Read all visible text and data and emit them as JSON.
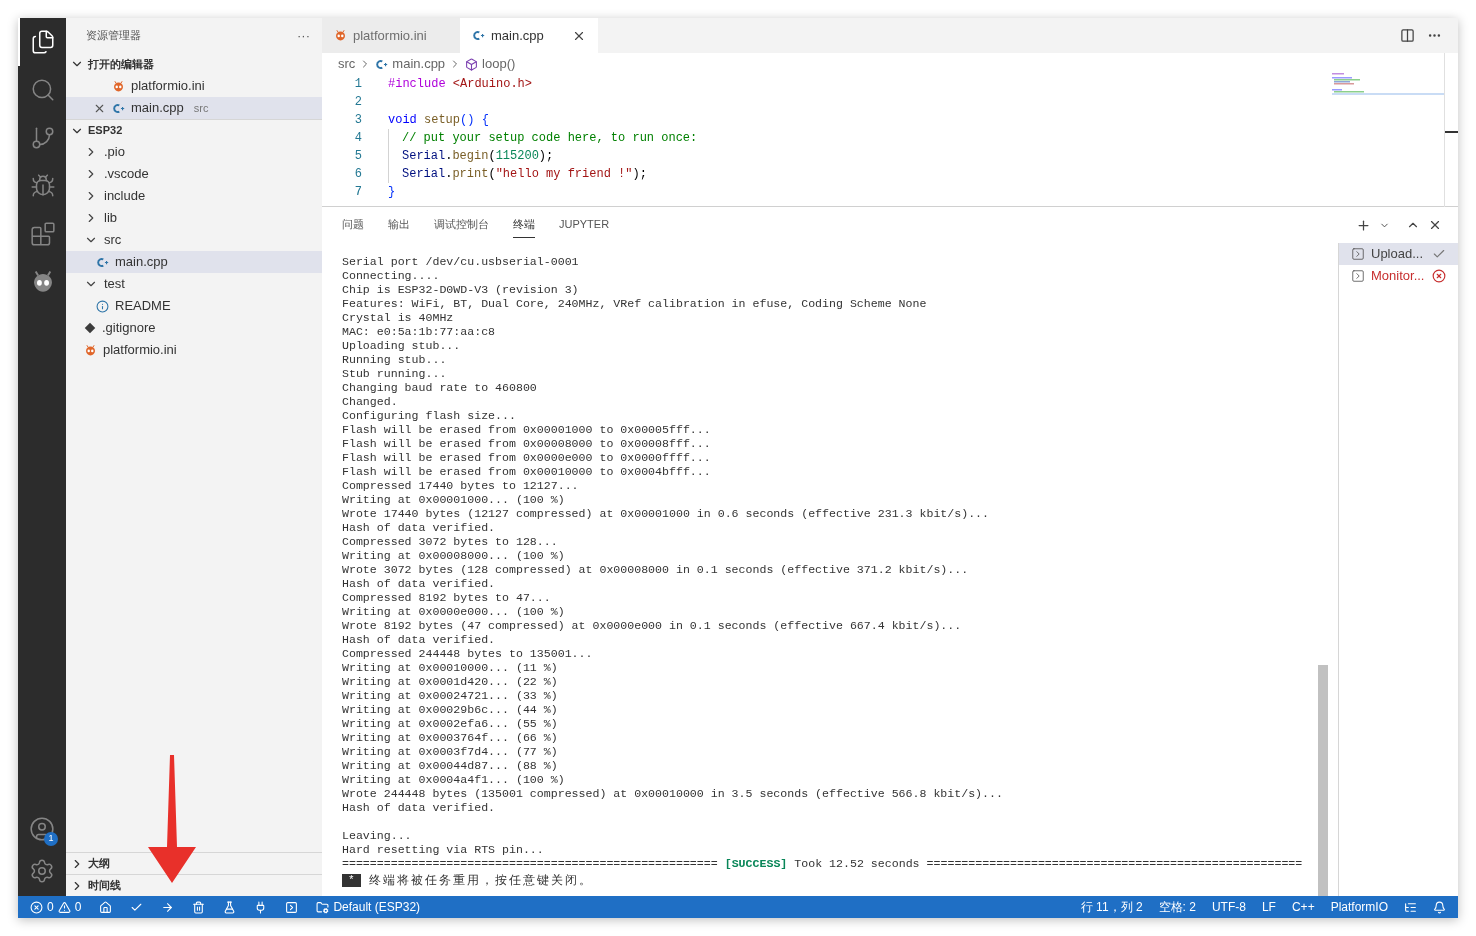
{
  "activity_bar": {
    "items": [
      {
        "kind": "explorer",
        "selected": true
      },
      {
        "kind": "search",
        "selected": false
      },
      {
        "kind": "scm",
        "selected": false
      },
      {
        "kind": "debug",
        "selected": false
      },
      {
        "kind": "extensions",
        "selected": false
      },
      {
        "kind": "platformio",
        "selected": false
      }
    ],
    "account_badge": "1"
  },
  "sidebar": {
    "title": "资源管理器",
    "more": "···",
    "open_editors": {
      "title": "打开的编辑器",
      "expanded": true,
      "items": [
        {
          "name": "platformio.ini",
          "kind": "pio",
          "selected": false,
          "close": false
        },
        {
          "name": "main.cpp",
          "kind": "cpp",
          "description": "src",
          "selected": true,
          "close": true
        }
      ]
    },
    "folder": {
      "title": "ESP32",
      "expanded": true,
      "children": [
        {
          "name": ".pio",
          "kind": "folder",
          "expanded": false,
          "selected": false
        },
        {
          "name": ".vscode",
          "kind": "folder",
          "expanded": false,
          "selected": false
        },
        {
          "name": "include",
          "kind": "folder",
          "expanded": false,
          "selected": false
        },
        {
          "name": "lib",
          "kind": "folder",
          "expanded": false,
          "selected": false
        },
        {
          "name": "src",
          "kind": "folder",
          "expanded": true,
          "selected": false,
          "children": [
            {
              "name": "main.cpp",
              "kind": "cpp",
              "selected": true
            }
          ]
        },
        {
          "name": "test",
          "kind": "folder",
          "expanded": true,
          "selected": false,
          "children": [
            {
              "name": "README",
              "kind": "info",
              "selected": false
            }
          ]
        },
        {
          "name": ".gitignore",
          "kind": "git",
          "selected": false
        },
        {
          "name": "platformio.ini",
          "kind": "pio",
          "selected": false
        }
      ]
    },
    "bottom_sections": [
      {
        "title": "大纲",
        "expanded": false
      },
      {
        "title": "时间线",
        "expanded": false
      }
    ]
  },
  "editor": {
    "tabs": [
      {
        "label": "platformio.ini",
        "kind": "pio",
        "selected": false
      },
      {
        "label": "main.cpp",
        "kind": "cpp",
        "selected": true
      }
    ],
    "breadcrumb": [
      {
        "label": "src",
        "kind": "folder"
      },
      {
        "label": "main.cpp",
        "kind": "cpp"
      },
      {
        "label": "loop()",
        "kind": "symbol"
      }
    ],
    "lines": [
      {
        "number": "1",
        "indent": false,
        "tokens": [
          {
            "text": "#include ",
            "kind": "preproc"
          },
          {
            "text": "<Arduino.h>",
            "kind": "string"
          }
        ]
      },
      {
        "number": "2",
        "indent": false
      },
      {
        "number": "3",
        "indent": false,
        "tokens": [
          {
            "text": "void ",
            "kind": "keyword"
          },
          {
            "text": "setup",
            "kind": "function"
          },
          {
            "text": "() {",
            "kind": "bracket"
          }
        ]
      },
      {
        "number": "4",
        "indent": true,
        "tokens": [
          {
            "text": "// put your setup code here, to run once:",
            "kind": "comment"
          }
        ]
      },
      {
        "number": "5",
        "indent": true,
        "tokens": [
          {
            "text": "Serial",
            "kind": "variable"
          },
          {
            "text": ".",
            "kind": "plain"
          },
          {
            "text": "begin",
            "kind": "function"
          },
          {
            "text": "(",
            "kind": "plain"
          },
          {
            "text": "115200",
            "kind": "number"
          },
          {
            "text": ");",
            "kind": "plain"
          }
        ]
      },
      {
        "number": "6",
        "indent": true,
        "tokens": [
          {
            "text": "Serial",
            "kind": "variable"
          },
          {
            "text": ".",
            "kind": "plain"
          },
          {
            "text": "print",
            "kind": "function"
          },
          {
            "text": "(",
            "kind": "plain"
          },
          {
            "text": "\"hello my friend !\"",
            "kind": "string"
          },
          {
            "text": ");",
            "kind": "plain"
          }
        ]
      },
      {
        "number": "7",
        "indent": false,
        "tokens": [
          {
            "text": "}",
            "kind": "bracket"
          }
        ]
      }
    ]
  },
  "panel": {
    "tabs": [
      {
        "label": "问题",
        "selected": false
      },
      {
        "label": "输出",
        "selected": false
      },
      {
        "label": "调试控制台",
        "selected": false
      },
      {
        "label": "终端",
        "selected": true
      },
      {
        "label": "JUPYTER",
        "selected": false
      }
    ],
    "terminal_blocks": [
      [
        "Serial port /dev/cu.usbserial-0001",
        "Connecting....",
        "Chip is ESP32-D0WD-V3 (revision 3)",
        "Features: WiFi, BT, Dual Core, 240MHz, VRef calibration in efuse, Coding Scheme None",
        "Crystal is 40MHz",
        "MAC: e0:5a:1b:77:aa:c8",
        "Uploading stub...",
        "Running stub...",
        "Stub running...",
        "Changing baud rate to 460800",
        "Changed.",
        "Configuring flash size...",
        "Flash will be erased from 0x00001000 to 0x00005fff...",
        "Flash will be erased from 0x00008000 to 0x00008fff...",
        "Flash will be erased from 0x0000e000 to 0x0000ffff...",
        "Flash will be erased from 0x00010000 to 0x0004bfff...",
        "Compressed 17440 bytes to 12127...",
        "Writing at 0x00001000... (100 %)",
        "Wrote 17440 bytes (12127 compressed) at 0x00001000 in 0.6 seconds (effective 231.3 kbit/s)...",
        "Hash of data verified.",
        "Compressed 3072 bytes to 128...",
        "Writing at 0x00008000... (100 %)",
        "Wrote 3072 bytes (128 compressed) at 0x00008000 in 0.1 seconds (effective 371.2 kbit/s)...",
        "Hash of data verified.",
        "Compressed 8192 bytes to 47...",
        "Writing at 0x0000e000... (100 %)",
        "Wrote 8192 bytes (47 compressed) at 0x0000e000 in 0.1 seconds (effective 667.4 kbit/s)...",
        "Hash of data verified.",
        "Compressed 244448 bytes to 135001...",
        "Writing at 0x00010000... (11 %)",
        "Writing at 0x0001d420... (22 %)",
        "Writing at 0x00024721... (33 %)",
        "Writing at 0x00029b6c... (44 %)",
        "Writing at 0x0002efa6... (55 %)",
        "Writing at 0x0003764f... (66 %)",
        "Writing at 0x0003f7d4... (77 %)",
        "Writing at 0x00044d87... (88 %)",
        "Writing at 0x0004a4f1... (100 %)",
        "Wrote 244448 bytes (135001 compressed) at 0x00010000 in 3.5 seconds (effective 566.8 kbit/s)...",
        "Hash of data verified."
      ],
      [
        "Leaving...",
        "Hard resetting via RTS pin..."
      ]
    ],
    "summary": {
      "left_rule": "======================================================",
      "label": "[SUCCESS]",
      "text": "Took 12.52 seconds",
      "right_rule": "======================================================"
    },
    "prompt": {
      "badge": "*",
      "text": "终端将被任务重用，按任意键关闭。"
    },
    "terminals": [
      {
        "label": "Upload...",
        "kind": "success",
        "selected": true
      },
      {
        "label": "Monitor...",
        "kind": "error",
        "selected": false
      }
    ]
  },
  "status_bar": {
    "errors": "0",
    "warnings": "0",
    "environment": "Default (ESP32)",
    "right": [
      "行 11，列 2",
      "空格: 2",
      "UTF-8",
      "LF",
      "C++",
      "PlatformIO"
    ]
  }
}
